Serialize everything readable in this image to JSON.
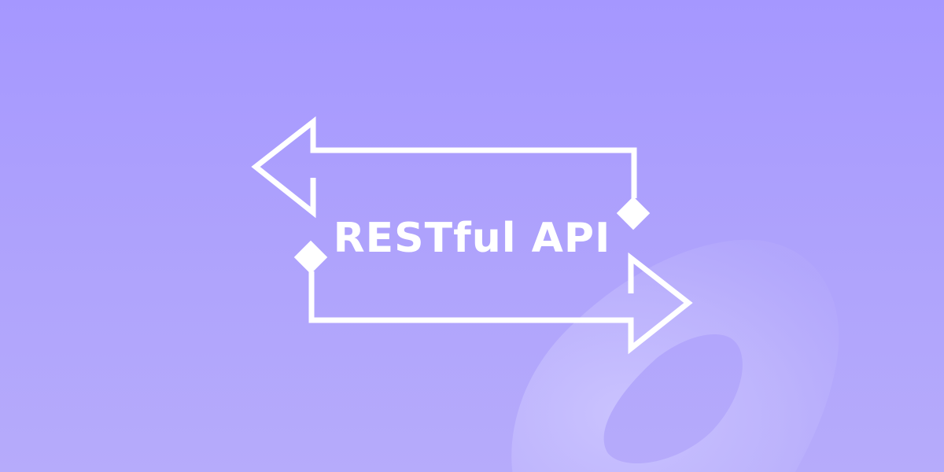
{
  "banner": {
    "title": "RESTful API",
    "colors": {
      "background_top": "#a597ff",
      "background_bottom": "#b6abfb",
      "foreground": "#ffffff",
      "torus": "#c3baff"
    },
    "icons": {
      "left_arrow": "arrow-left-icon",
      "right_arrow": "arrow-right-icon",
      "decoration": "torus-shape"
    }
  }
}
